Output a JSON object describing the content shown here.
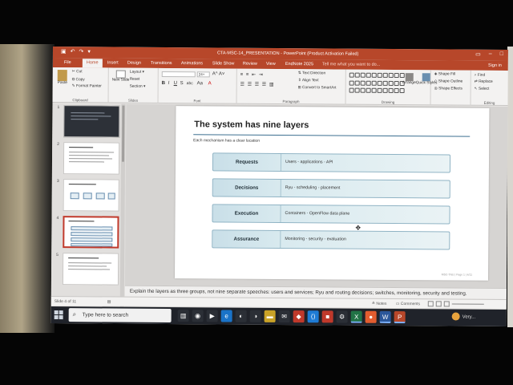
{
  "window": {
    "title": "CTA-MSC-14_PRESENTATION - PowerPoint (Product Activation Failed)",
    "sign_in": "Sign in",
    "tell_me": "Tell me what you want to do..."
  },
  "tabs": [
    "File",
    "Home",
    "Insert",
    "Design",
    "Transitions",
    "Animations",
    "Slide Show",
    "Review",
    "View",
    "EndNote 2025"
  ],
  "active_tab": "Home",
  "ribbon": {
    "clipboard": {
      "label": "Clipboard",
      "paste": "Paste",
      "cut": "Cut",
      "copy": "Copy",
      "format_painter": "Format Painter"
    },
    "slides": {
      "label": "Slides",
      "new_slide": "New Slide",
      "layout": "Layout",
      "reset": "Reset",
      "section": "Section"
    },
    "font": {
      "label": "Font",
      "size": "24+"
    },
    "paragraph": {
      "label": "Paragraph",
      "text_direction": "Text Direction",
      "align_text": "Align Text",
      "convert_smartart": "Convert to SmartArt"
    },
    "drawing": {
      "label": "Drawing",
      "arrange": "Arrange",
      "quick_styles": "Quick Styles",
      "shape_fill": "Shape Fill",
      "shape_outline": "Shape Outline",
      "shape_effects": "Shape Effects"
    },
    "editing": {
      "label": "Editing",
      "find": "Find",
      "replace": "Replace",
      "select": "Select"
    }
  },
  "thumbnails": [
    {
      "num": "1",
      "style": "dark"
    },
    {
      "num": "2",
      "style": "text"
    },
    {
      "num": "3",
      "style": "boxes"
    },
    {
      "num": "4",
      "style": "layers",
      "selected": true
    },
    {
      "num": "5",
      "style": "text"
    }
  ],
  "slide": {
    "title": "The system has nine layers",
    "subtitle": "Each mechanism has a clear location",
    "layers": [
      {
        "label": "Requests",
        "desc": "Users - applications - API"
      },
      {
        "label": "Decisions",
        "desc": "Ryu - scheduling - placement"
      },
      {
        "label": "Execution",
        "desc": "Containers - OpenFlow data plane"
      },
      {
        "label": "Assurance",
        "desc": "Monitoring - security - evaluation"
      }
    ],
    "footer": "MSC-TNU | Page 1 | 4/11"
  },
  "notes": "Explain the layers as three groups, not nine separate speeches: users and services; Ryu and routing decisions; switches, monitoring, security and testing.",
  "status": {
    "slide_count": "Slide 4 of 11",
    "notes_btn": "Notes",
    "comments_btn": "Comments"
  },
  "taskbar": {
    "search_placeholder": "Type here to search",
    "weather": "Very..."
  },
  "colors": {
    "accent": "#b7472a",
    "layer_fill": "#d9eaef",
    "layer_border": "#8fb3c4",
    "title_rule": "#3c6f90"
  }
}
